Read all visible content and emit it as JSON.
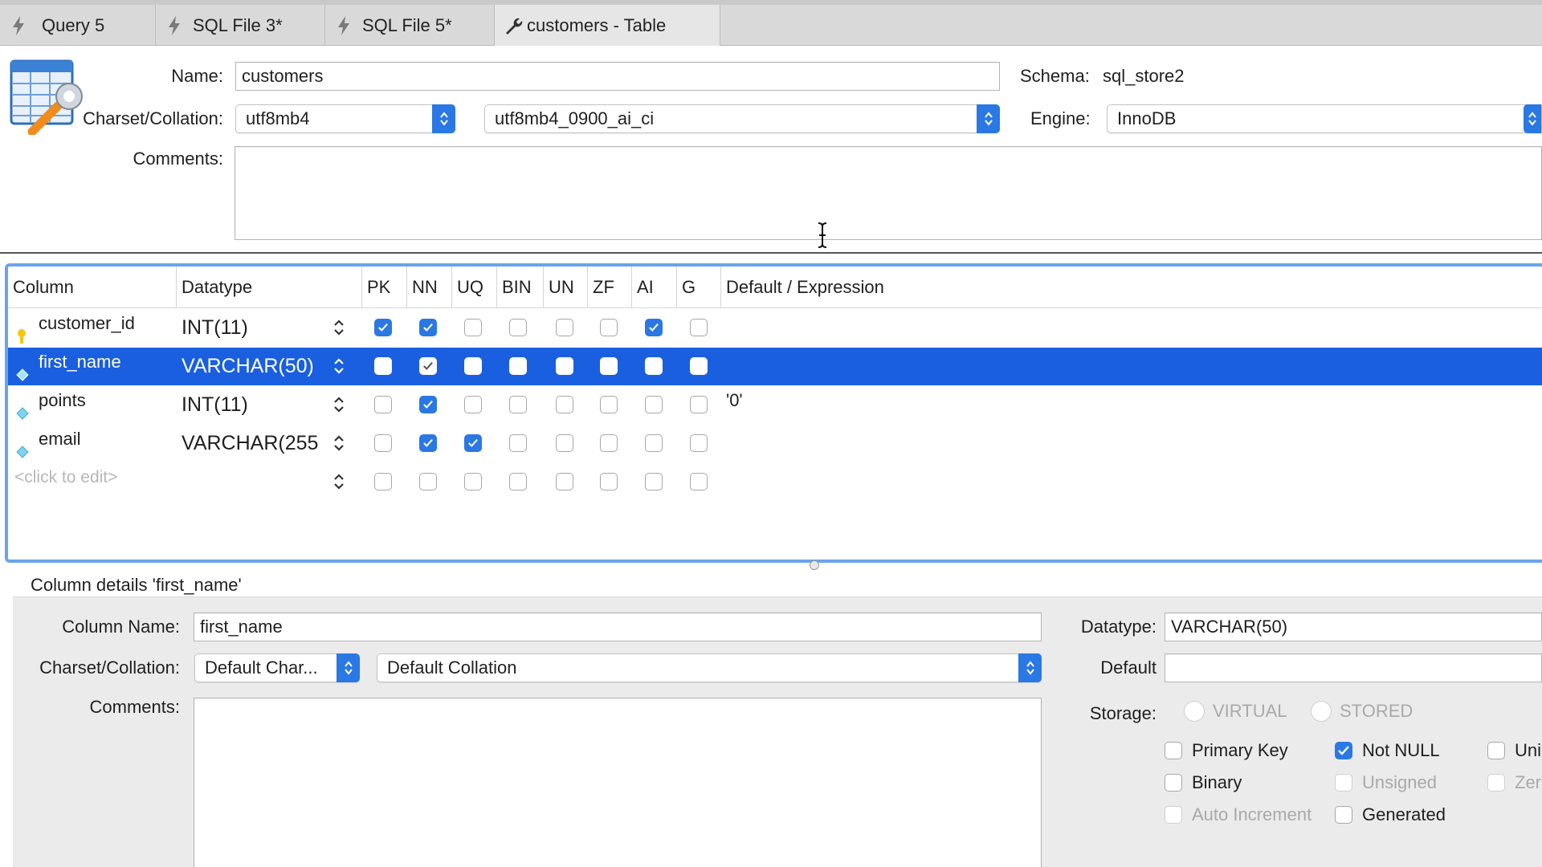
{
  "tabs": [
    {
      "label": "Query 5",
      "icon": "lightning-icon"
    },
    {
      "label": "SQL File 3*",
      "icon": "lightning-icon"
    },
    {
      "label": "SQL File 5*",
      "icon": "lightning-icon"
    },
    {
      "label": "customers - Table",
      "icon": "wrench-icon",
      "active": true
    }
  ],
  "table": {
    "name_label": "Name:",
    "name_value": "customers",
    "schema_label": "Schema:",
    "schema_value": "sql_store2",
    "charset_label": "Charset/Collation:",
    "charset_value": "utf8mb4",
    "collation_value": "utf8mb4_0900_ai_ci",
    "engine_label": "Engine:",
    "engine_value": "InnoDB",
    "comments_label": "Comments:"
  },
  "grid": {
    "headers": [
      "Column",
      "Datatype",
      "PK",
      "NN",
      "UQ",
      "BIN",
      "UN",
      "ZF",
      "AI",
      "G",
      "Default / Expression"
    ],
    "rows": [
      {
        "name": "customer_id",
        "type": "INT(11)",
        "key": "primary",
        "flags": [
          true,
          true,
          false,
          false,
          false,
          false,
          true,
          false
        ],
        "default": ""
      },
      {
        "name": "first_name",
        "type": "VARCHAR(50)",
        "key": "column",
        "flags": [
          false,
          true,
          false,
          false,
          false,
          false,
          false,
          false
        ],
        "default": "",
        "selected": true
      },
      {
        "name": "points",
        "type": "INT(11)",
        "key": "column",
        "flags": [
          false,
          true,
          false,
          false,
          false,
          false,
          false,
          false
        ],
        "default": "'0'"
      },
      {
        "name": "email",
        "type": "VARCHAR(255",
        "key": "column",
        "flags": [
          false,
          true,
          true,
          false,
          false,
          false,
          false,
          false
        ],
        "default": ""
      }
    ],
    "placeholder": "<click to edit>"
  },
  "details": {
    "title": "Column details 'first_name'",
    "column_name_label": "Column Name:",
    "column_name_value": "first_name",
    "charset_label": "Charset/Collation:",
    "charset_value": "Default Char...",
    "collation_value": "Default Collation",
    "comments_label": "Comments:",
    "datatype_label": "Datatype:",
    "datatype_value": "VARCHAR(50)",
    "default_label": "Default",
    "default_value": "",
    "storage_label": "Storage:",
    "virtual_label": "VIRTUAL",
    "stored_label": "STORED",
    "primary_key_label": "Primary Key",
    "not_null_label": "Not NULL",
    "unique_label": "Uni",
    "binary_label": "Binary",
    "unsigned_label": "Unsigned",
    "zerofill_label": "Zer",
    "auto_increment_label": "Auto Increment",
    "generated_label": "Generated",
    "not_null_checked": true
  },
  "colors": {
    "accent": "#2a78e4",
    "selection": "#1a5fe0",
    "grid_border": "#6aa4ec"
  }
}
